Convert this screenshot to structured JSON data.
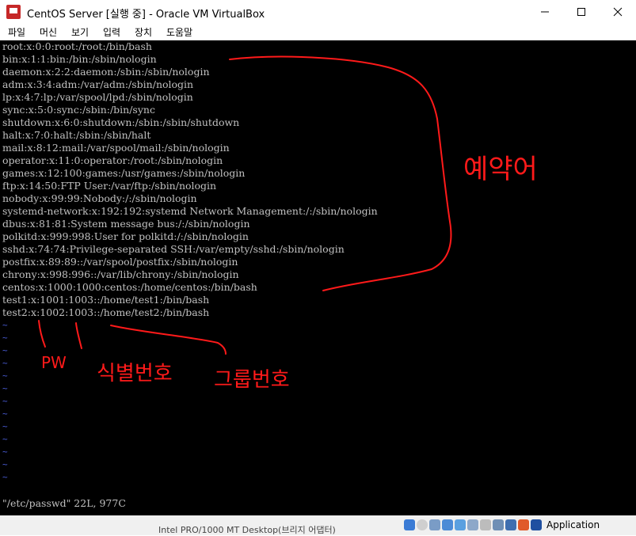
{
  "window": {
    "title": "CentOS Server [실행 중] - Oracle VM VirtualBox",
    "minimize_label": "—",
    "maximize_label": "☐",
    "close_label": "✕"
  },
  "menu": {
    "items": [
      "파일",
      "머신",
      "보기",
      "입력",
      "장치",
      "도움말"
    ]
  },
  "terminal": {
    "lines": [
      "root:x:0:0:root:/root:/bin/bash",
      "bin:x:1:1:bin:/bin:/sbin/nologin",
      "daemon:x:2:2:daemon:/sbin:/sbin/nologin",
      "adm:x:3:4:adm:/var/adm:/sbin/nologin",
      "lp:x:4:7:lp:/var/spool/lpd:/sbin/nologin",
      "sync:x:5:0:sync:/sbin:/bin/sync",
      "shutdown:x:6:0:shutdown:/sbin:/sbin/shutdown",
      "halt:x:7:0:halt:/sbin:/sbin/halt",
      "mail:x:8:12:mail:/var/spool/mail:/sbin/nologin",
      "operator:x:11:0:operator:/root:/sbin/nologin",
      "games:x:12:100:games:/usr/games:/sbin/nologin",
      "ftp:x:14:50:FTP User:/var/ftp:/sbin/nologin",
      "nobody:x:99:99:Nobody:/:/sbin/nologin",
      "systemd-network:x:192:192:systemd Network Management:/:/sbin/nologin",
      "dbus:x:81:81:System message bus:/:/sbin/nologin",
      "polkitd:x:999:998:User for polkitd:/:/sbin/nologin",
      "sshd:x:74:74:Privilege-separated SSH:/var/empty/sshd:/sbin/nologin",
      "postfix:x:89:89::/var/spool/postfix:/sbin/nologin",
      "chrony:x:998:996::/var/lib/chrony:/sbin/nologin",
      "centos:x:1000:1000:centos:/home/centos:/bin/bash",
      "test1:x:1001:1003::/home/test1:/bin/bash",
      "test2:x:1002:1003::/home/test2:/bin/bash"
    ],
    "tilde": "~",
    "tilde_count": 13,
    "status": "\"/etc/passwd\" 22L, 977C"
  },
  "annotations": {
    "color": "#ff1a1a",
    "reserved": "예약어",
    "pw": "PW",
    "uid": "식별번호",
    "gid": "그룹번호"
  },
  "statusbar": {
    "host_key": "Application",
    "background_text": "Intel PRO/1000 MT Desktop(브리지 어댑터)"
  }
}
